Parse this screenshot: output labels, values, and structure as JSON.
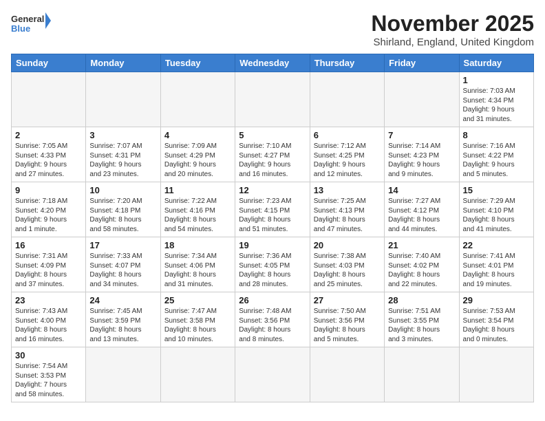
{
  "header": {
    "logo_general": "General",
    "logo_blue": "Blue",
    "month": "November 2025",
    "location": "Shirland, England, United Kingdom"
  },
  "days_of_week": [
    "Sunday",
    "Monday",
    "Tuesday",
    "Wednesday",
    "Thursday",
    "Friday",
    "Saturday"
  ],
  "weeks": [
    [
      {
        "day": "",
        "info": ""
      },
      {
        "day": "",
        "info": ""
      },
      {
        "day": "",
        "info": ""
      },
      {
        "day": "",
        "info": ""
      },
      {
        "day": "",
        "info": ""
      },
      {
        "day": "",
        "info": ""
      },
      {
        "day": "1",
        "info": "Sunrise: 7:03 AM\nSunset: 4:34 PM\nDaylight: 9 hours\nand 31 minutes."
      }
    ],
    [
      {
        "day": "2",
        "info": "Sunrise: 7:05 AM\nSunset: 4:33 PM\nDaylight: 9 hours\nand 27 minutes."
      },
      {
        "day": "3",
        "info": "Sunrise: 7:07 AM\nSunset: 4:31 PM\nDaylight: 9 hours\nand 23 minutes."
      },
      {
        "day": "4",
        "info": "Sunrise: 7:09 AM\nSunset: 4:29 PM\nDaylight: 9 hours\nand 20 minutes."
      },
      {
        "day": "5",
        "info": "Sunrise: 7:10 AM\nSunset: 4:27 PM\nDaylight: 9 hours\nand 16 minutes."
      },
      {
        "day": "6",
        "info": "Sunrise: 7:12 AM\nSunset: 4:25 PM\nDaylight: 9 hours\nand 12 minutes."
      },
      {
        "day": "7",
        "info": "Sunrise: 7:14 AM\nSunset: 4:23 PM\nDaylight: 9 hours\nand 9 minutes."
      },
      {
        "day": "8",
        "info": "Sunrise: 7:16 AM\nSunset: 4:22 PM\nDaylight: 9 hours\nand 5 minutes."
      }
    ],
    [
      {
        "day": "9",
        "info": "Sunrise: 7:18 AM\nSunset: 4:20 PM\nDaylight: 9 hours\nand 1 minute."
      },
      {
        "day": "10",
        "info": "Sunrise: 7:20 AM\nSunset: 4:18 PM\nDaylight: 8 hours\nand 58 minutes."
      },
      {
        "day": "11",
        "info": "Sunrise: 7:22 AM\nSunset: 4:16 PM\nDaylight: 8 hours\nand 54 minutes."
      },
      {
        "day": "12",
        "info": "Sunrise: 7:23 AM\nSunset: 4:15 PM\nDaylight: 8 hours\nand 51 minutes."
      },
      {
        "day": "13",
        "info": "Sunrise: 7:25 AM\nSunset: 4:13 PM\nDaylight: 8 hours\nand 47 minutes."
      },
      {
        "day": "14",
        "info": "Sunrise: 7:27 AM\nSunset: 4:12 PM\nDaylight: 8 hours\nand 44 minutes."
      },
      {
        "day": "15",
        "info": "Sunrise: 7:29 AM\nSunset: 4:10 PM\nDaylight: 8 hours\nand 41 minutes."
      }
    ],
    [
      {
        "day": "16",
        "info": "Sunrise: 7:31 AM\nSunset: 4:09 PM\nDaylight: 8 hours\nand 37 minutes."
      },
      {
        "day": "17",
        "info": "Sunrise: 7:33 AM\nSunset: 4:07 PM\nDaylight: 8 hours\nand 34 minutes."
      },
      {
        "day": "18",
        "info": "Sunrise: 7:34 AM\nSunset: 4:06 PM\nDaylight: 8 hours\nand 31 minutes."
      },
      {
        "day": "19",
        "info": "Sunrise: 7:36 AM\nSunset: 4:05 PM\nDaylight: 8 hours\nand 28 minutes."
      },
      {
        "day": "20",
        "info": "Sunrise: 7:38 AM\nSunset: 4:03 PM\nDaylight: 8 hours\nand 25 minutes."
      },
      {
        "day": "21",
        "info": "Sunrise: 7:40 AM\nSunset: 4:02 PM\nDaylight: 8 hours\nand 22 minutes."
      },
      {
        "day": "22",
        "info": "Sunrise: 7:41 AM\nSunset: 4:01 PM\nDaylight: 8 hours\nand 19 minutes."
      }
    ],
    [
      {
        "day": "23",
        "info": "Sunrise: 7:43 AM\nSunset: 4:00 PM\nDaylight: 8 hours\nand 16 minutes."
      },
      {
        "day": "24",
        "info": "Sunrise: 7:45 AM\nSunset: 3:59 PM\nDaylight: 8 hours\nand 13 minutes."
      },
      {
        "day": "25",
        "info": "Sunrise: 7:47 AM\nSunset: 3:58 PM\nDaylight: 8 hours\nand 10 minutes."
      },
      {
        "day": "26",
        "info": "Sunrise: 7:48 AM\nSunset: 3:56 PM\nDaylight: 8 hours\nand 8 minutes."
      },
      {
        "day": "27",
        "info": "Sunrise: 7:50 AM\nSunset: 3:56 PM\nDaylight: 8 hours\nand 5 minutes."
      },
      {
        "day": "28",
        "info": "Sunrise: 7:51 AM\nSunset: 3:55 PM\nDaylight: 8 hours\nand 3 minutes."
      },
      {
        "day": "29",
        "info": "Sunrise: 7:53 AM\nSunset: 3:54 PM\nDaylight: 8 hours\nand 0 minutes."
      }
    ],
    [
      {
        "day": "30",
        "info": "Sunrise: 7:54 AM\nSunset: 3:53 PM\nDaylight: 7 hours\nand 58 minutes."
      },
      {
        "day": "",
        "info": ""
      },
      {
        "day": "",
        "info": ""
      },
      {
        "day": "",
        "info": ""
      },
      {
        "day": "",
        "info": ""
      },
      {
        "day": "",
        "info": ""
      },
      {
        "day": "",
        "info": ""
      }
    ]
  ]
}
